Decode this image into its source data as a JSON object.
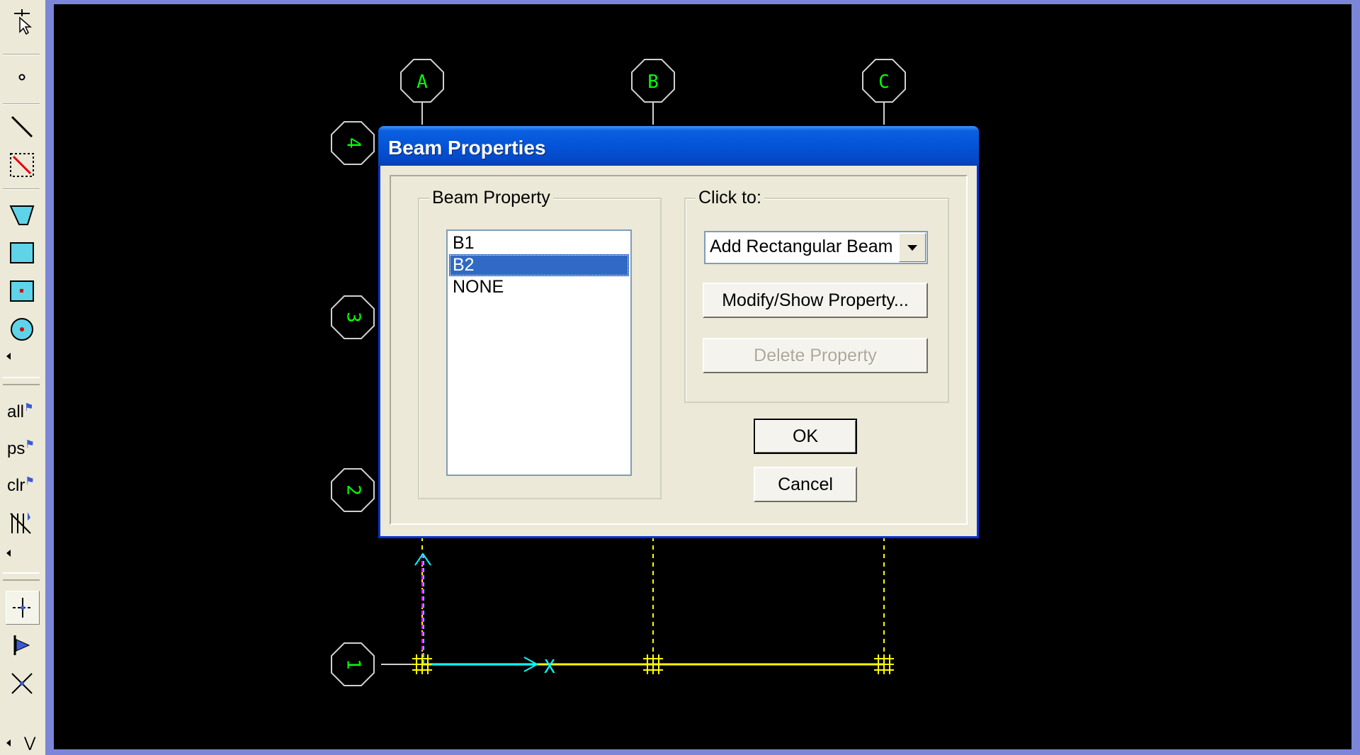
{
  "toolbar": {
    "buttons": [
      {
        "icon": "pointer-select-icon"
      },
      {
        "icon": "point-icon"
      },
      {
        "icon": "draw-line-icon"
      },
      {
        "icon": "draw-line-region-icon"
      },
      {
        "icon": "draw-polygon-area-icon"
      },
      {
        "icon": "draw-rectangle-area-icon"
      },
      {
        "icon": "draw-rectangle-at-click-icon"
      },
      {
        "icon": "draw-circle-icon"
      },
      {
        "icon": "snap-points-icon"
      },
      {
        "icon": "snap-ends-icon"
      },
      {
        "icon": "snap-intersections-icon"
      }
    ],
    "select_all_label": "all",
    "previous_selection_label": "ps",
    "clear_selection_label": "clr"
  },
  "canvas": {
    "background": "#000000",
    "grid_bubble_color": "#00ff00",
    "x_grid_labels": [
      "A",
      "B",
      "C"
    ],
    "y_grid_labels": [
      "4",
      "3",
      "2",
      "1"
    ],
    "axis_x_label": "X",
    "beam_color": "#ffff00",
    "axis_color": "#00ffff"
  },
  "dialog": {
    "title": "Beam Properties",
    "beam_property_group_label": "Beam Property",
    "beam_property_items": [
      "B1",
      "B2",
      "NONE"
    ],
    "selected_item": "B2",
    "click_to_group_label": "Click to:",
    "click_to_selected": "Add Rectangular Beam",
    "modify_show_button": "Modify/Show Property...",
    "delete_button": "Delete Property",
    "ok_button": "OK",
    "cancel_button": "Cancel"
  }
}
